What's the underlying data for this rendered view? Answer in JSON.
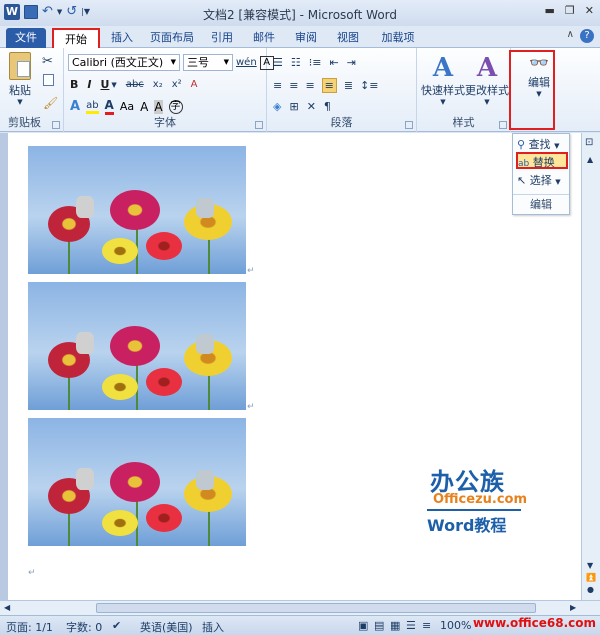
{
  "title_bar": {
    "app_icon": "W",
    "title": "文档2 [兼容模式] - Microsoft Word",
    "qat_icons": [
      "save-icon",
      "undo-icon",
      "redo-icon",
      "customize-icon"
    ]
  },
  "tabs": [
    "文件",
    "开始",
    "插入",
    "页面布局",
    "引用",
    "邮件",
    "审阅",
    "视图",
    "加载项"
  ],
  "ribbon": {
    "clipboard": {
      "paste": "粘贴",
      "label": "剪贴板"
    },
    "font": {
      "name": "Calibri (西文正文)",
      "size": "三号",
      "label": "字体"
    },
    "paragraph": {
      "label": "段落"
    },
    "styles": {
      "quick": "快速样式",
      "change": "更改样式",
      "label": "样式"
    },
    "editing": {
      "label": "编辑"
    }
  },
  "dropdown": {
    "find": "查找",
    "replace": "替换",
    "select": "选择",
    "group_label": "编辑"
  },
  "logo": {
    "name": "办公族",
    "domain": "Officezu.com",
    "tag": "Word教程"
  },
  "status": {
    "page": "页面: 1/1",
    "words": "字数: 0",
    "language": "英语(美国)",
    "mode": "插入",
    "zoom": "100%",
    "watermark": "www.office68.com"
  },
  "colors": {
    "accent": "#2a5ca8",
    "highlight": "#e02020"
  }
}
